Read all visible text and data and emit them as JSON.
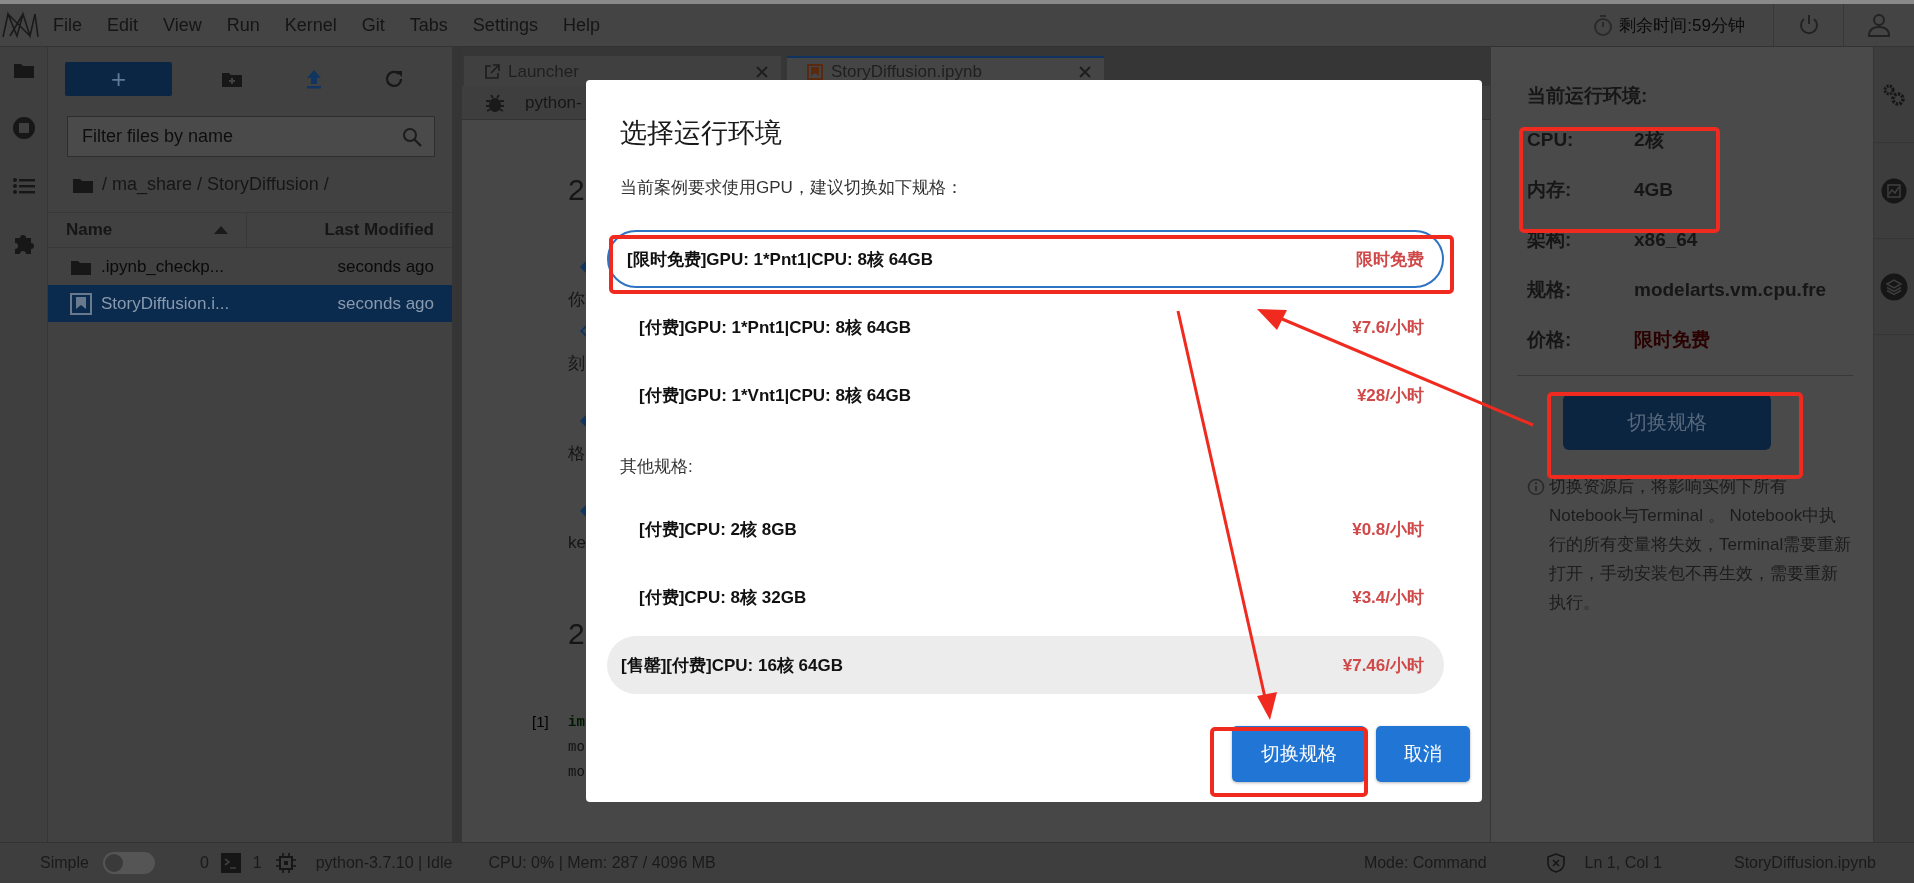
{
  "menu_bar": {
    "items": [
      "File",
      "Edit",
      "View",
      "Run",
      "Kernel",
      "Git",
      "Tabs",
      "Settings",
      "Help"
    ],
    "timer": "剩余时间:59分钟"
  },
  "file_browser": {
    "new_button": "+",
    "filter_placeholder": "Filter files by name",
    "breadcrumb": "/ ma_share / StoryDiffusion /",
    "columns": [
      "Name",
      "Last Modified"
    ],
    "rows": [
      {
        "name": ".ipynb_checkp...",
        "kind": "folder",
        "modified": "seconds ago",
        "selected": false
      },
      {
        "name": "StoryDiffusion.i...",
        "kind": "notebook",
        "modified": "seconds ago",
        "selected": true
      }
    ]
  },
  "notebook": {
    "tabs": [
      {
        "label": "Launcher",
        "kind": "launcher",
        "selected": false
      },
      {
        "label": "StoryDiffusion.ipynb",
        "kind": "notebook",
        "selected": true
      }
    ],
    "kernel_label": "python-",
    "lines": [
      {
        "kind": "heading",
        "text": "2"
      },
      {
        "kind": "bullet"
      },
      {
        "kind": "text",
        "text": "你"
      },
      {
        "kind": "outline-bullet"
      },
      {
        "kind": "text",
        "text": "刻"
      },
      {
        "kind": "bullet"
      },
      {
        "kind": "text",
        "text": "格"
      },
      {
        "kind": "bullet"
      },
      {
        "kind": "text",
        "text": "ke"
      },
      {
        "kind": "heading2",
        "text": "2"
      },
      {
        "kind": "code",
        "prompt": "[1]",
        "text": "im"
      },
      {
        "kind": "code",
        "text": "mo"
      },
      {
        "kind": "code",
        "text": "mo"
      }
    ]
  },
  "dialog": {
    "title": "选择运行环境",
    "subtitle": "当前案例要求使用GPU，建议切换如下规格：",
    "recommended": [
      {
        "label": "[限时免费]GPU: 1*Pnt1|CPU: 8核 64GB",
        "price": "限时免费",
        "selected": true,
        "sold_out": false
      },
      {
        "label": "[付费]GPU: 1*Pnt1|CPU: 8核 64GB",
        "price": "¥7.6/小时",
        "selected": false,
        "sold_out": false
      },
      {
        "label": "[付费]GPU: 1*Vnt1|CPU: 8核 64GB",
        "price": "¥28/小时",
        "selected": false,
        "sold_out": false
      }
    ],
    "other_heading": "其他规格:",
    "others": [
      {
        "label": "[付费]CPU: 2核 8GB",
        "price": "¥0.8/小时",
        "selected": false,
        "sold_out": false
      },
      {
        "label": "[付费]CPU: 8核 32GB",
        "price": "¥3.4/小时",
        "selected": false,
        "sold_out": false
      },
      {
        "label": "[售罄][付费]CPU: 16核 64GB",
        "price": "¥7.46/小时",
        "selected": false,
        "sold_out": true
      }
    ],
    "buttons": [
      "切换规格",
      "取消"
    ]
  },
  "environment_panel": {
    "title": "当前运行环境:",
    "rows": [
      {
        "label": "CPU:",
        "value": "2核",
        "kind": "plain"
      },
      {
        "label": "内存:",
        "value": "4GB",
        "kind": "plain"
      },
      {
        "label": "架构:",
        "value": "x86_64",
        "kind": "plain"
      },
      {
        "label": "规格:",
        "value": "modelarts.vm.cpu.fre",
        "kind": "plain"
      },
      {
        "label": "价格:",
        "value": "限时免费",
        "kind": "price"
      }
    ],
    "button": "切换规格",
    "note": "切换资源后，将影响实例下所有Notebook与Terminal 。 Notebook中执行的所有变量将失效，Terminal需要重新打开，手动安装包不再生效，需要重新执行。"
  },
  "status_bar": {
    "mode_label": "Simple",
    "simple_on": false,
    "terminals": "0",
    "kernels": "1",
    "kernel": "python-3.7.10 | Idle",
    "resources": "CPU: 0% | Mem: 287 / 4096 MB",
    "mode": "Mode: Command",
    "position": "Ln 1, Col 1",
    "file": "StoryDiffusion.ipynb"
  }
}
